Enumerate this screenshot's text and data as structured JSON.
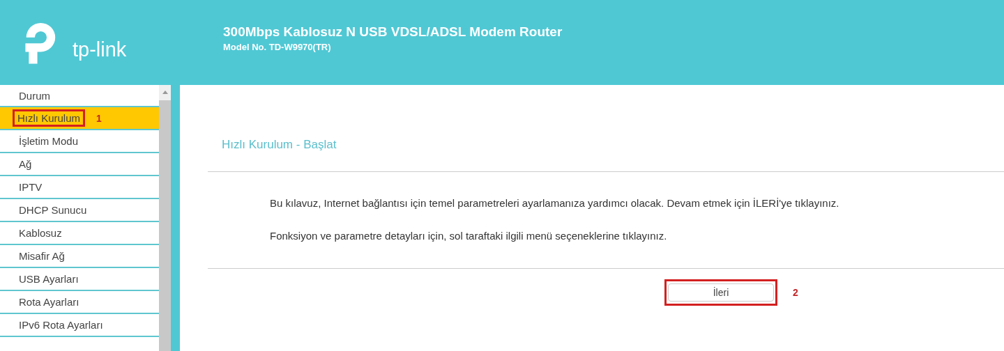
{
  "header": {
    "logo_text": "tp-link",
    "title": "300Mbps Kablosuz N USB VDSL/ADSL Modem Router",
    "model": "Model No. TD-W9970(TR)"
  },
  "sidebar": {
    "items": [
      {
        "label": "Durum",
        "selected": false
      },
      {
        "label": "Hızlı Kurulum",
        "selected": true,
        "callout": "1"
      },
      {
        "label": "İşletim Modu",
        "selected": false
      },
      {
        "label": "Ağ",
        "selected": false
      },
      {
        "label": "IPTV",
        "selected": false
      },
      {
        "label": "DHCP Sunucu",
        "selected": false
      },
      {
        "label": "Kablosuz",
        "selected": false
      },
      {
        "label": "Misafir Ağ",
        "selected": false
      },
      {
        "label": "USB Ayarları",
        "selected": false
      },
      {
        "label": "Rota Ayarları",
        "selected": false
      },
      {
        "label": "IPv6 Rota Ayarları",
        "selected": false
      }
    ]
  },
  "content": {
    "title": "Hızlı Kurulum - Başlat",
    "paragraphs": [
      "Bu kılavuz, Internet bağlantısı için temel parametreleri ayarlamanıza yardımcı olacak. Devam etmek için İLERİ'ye tıklayınız.",
      "Fonksiyon ve parametre detayları için, sol taraftaki ilgili menü seçeneklerine tıklayınız."
    ],
    "next_button": {
      "label": "İleri",
      "callout": "2"
    }
  }
}
